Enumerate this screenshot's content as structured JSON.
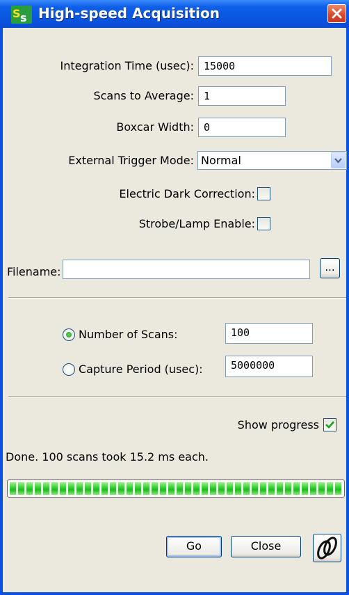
{
  "window": {
    "title": "High-speed Acquisition",
    "app_icon_text": "SS",
    "title_bar_color": "#0a54e0"
  },
  "form": {
    "integration_time_label": "Integration Time (usec):",
    "integration_time_value": "15000",
    "scans_to_average_label": "Scans to Average:",
    "scans_to_average_value": "1",
    "boxcar_width_label": "Boxcar Width:",
    "boxcar_width_value": "0",
    "trigger_mode_label": "External Trigger Mode:",
    "trigger_mode_value": "Normal",
    "dark_correction_label": "Electric Dark Correction:",
    "dark_correction_checked": false,
    "strobe_label": "Strobe/Lamp Enable:",
    "strobe_checked": false,
    "filename_label": "Filename:",
    "filename_value": "",
    "browse_label": "..."
  },
  "acquisition": {
    "num_scans_label": "Number of Scans:",
    "num_scans_value": "100",
    "num_scans_selected": true,
    "capture_period_label": "Capture Period (usec):",
    "capture_period_value": "5000000",
    "capture_period_selected": false
  },
  "progress": {
    "show_progress_label": "Show progress",
    "show_progress_checked": true,
    "status_text": "Done.  100 scans took 15.2 ms each.",
    "fraction": 1.0,
    "bar_color": "#2ecc2e"
  },
  "buttons": {
    "go_label": "Go",
    "close_label": "Close",
    "link_icon": "link-icon"
  }
}
